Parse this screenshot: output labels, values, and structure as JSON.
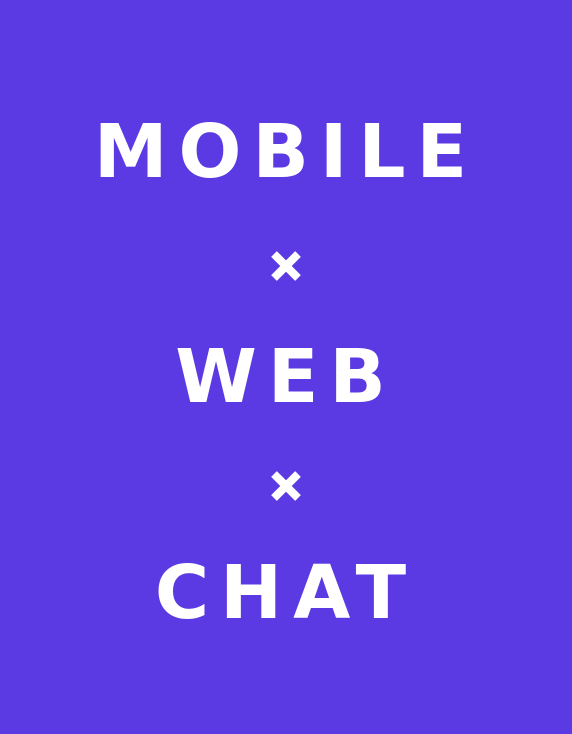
{
  "background_color": "#5b3ae3",
  "text_color": "#ffffff",
  "lines": [
    {
      "text": "MOBILE"
    },
    {
      "separator_icon": "times-icon"
    },
    {
      "text": "WEB"
    },
    {
      "separator_icon": "times-icon"
    },
    {
      "text": "CHAT"
    }
  ]
}
